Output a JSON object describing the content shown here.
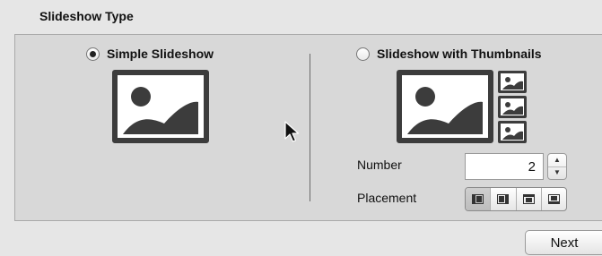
{
  "section": {
    "title": "Slideshow Type"
  },
  "options": {
    "simple": {
      "label": "Simple Slideshow",
      "checked": true
    },
    "thumbs": {
      "label": "Slideshow with Thumbnails",
      "checked": false
    }
  },
  "number": {
    "label": "Number",
    "value": "2"
  },
  "placement": {
    "label": "Placement",
    "options": [
      "thumbnails-left",
      "thumbnails-right",
      "thumbnails-top",
      "thumbnails-bottom"
    ],
    "selected": "thumbnails-left"
  },
  "footer": {
    "next_label": "Next"
  },
  "icons": {
    "image_placeholder": "image-icon",
    "cursor": "arrow-cursor-icon"
  }
}
